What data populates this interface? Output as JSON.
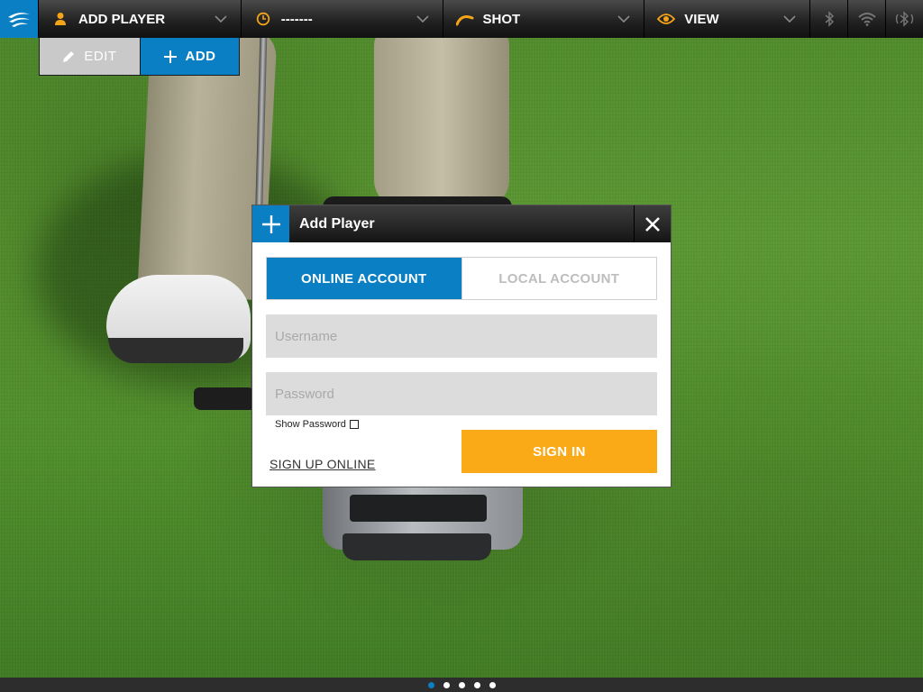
{
  "topbar": {
    "menus": [
      {
        "label": "ADD PLAYER",
        "icon": "person-icon"
      },
      {
        "label": "-------",
        "icon": "clock-icon"
      },
      {
        "label": "SHOT",
        "icon": "shot-arc-icon"
      },
      {
        "label": "VIEW",
        "icon": "eye-icon"
      }
    ],
    "status_icons": [
      "bluetooth-icon",
      "wifi-icon",
      "device-signal-icon"
    ]
  },
  "subbar": {
    "edit_label": "EDIT",
    "add_label": "ADD"
  },
  "dialog": {
    "title": "Add Player",
    "tabs": [
      {
        "label": "ONLINE ACCOUNT",
        "active": true
      },
      {
        "label": "LOCAL ACCOUNT",
        "active": false
      }
    ],
    "username_placeholder": "Username",
    "password_placeholder": "Password",
    "show_password_label": "Show Password",
    "signup_label": "SIGN UP ONLINE",
    "signin_label": "SIGN IN"
  },
  "pager": {
    "count": 5,
    "active_index": 0
  },
  "colors": {
    "accent_blue": "#0a7fc3",
    "accent_orange": "#fbaa17",
    "icon_orange": "#f5a418"
  }
}
